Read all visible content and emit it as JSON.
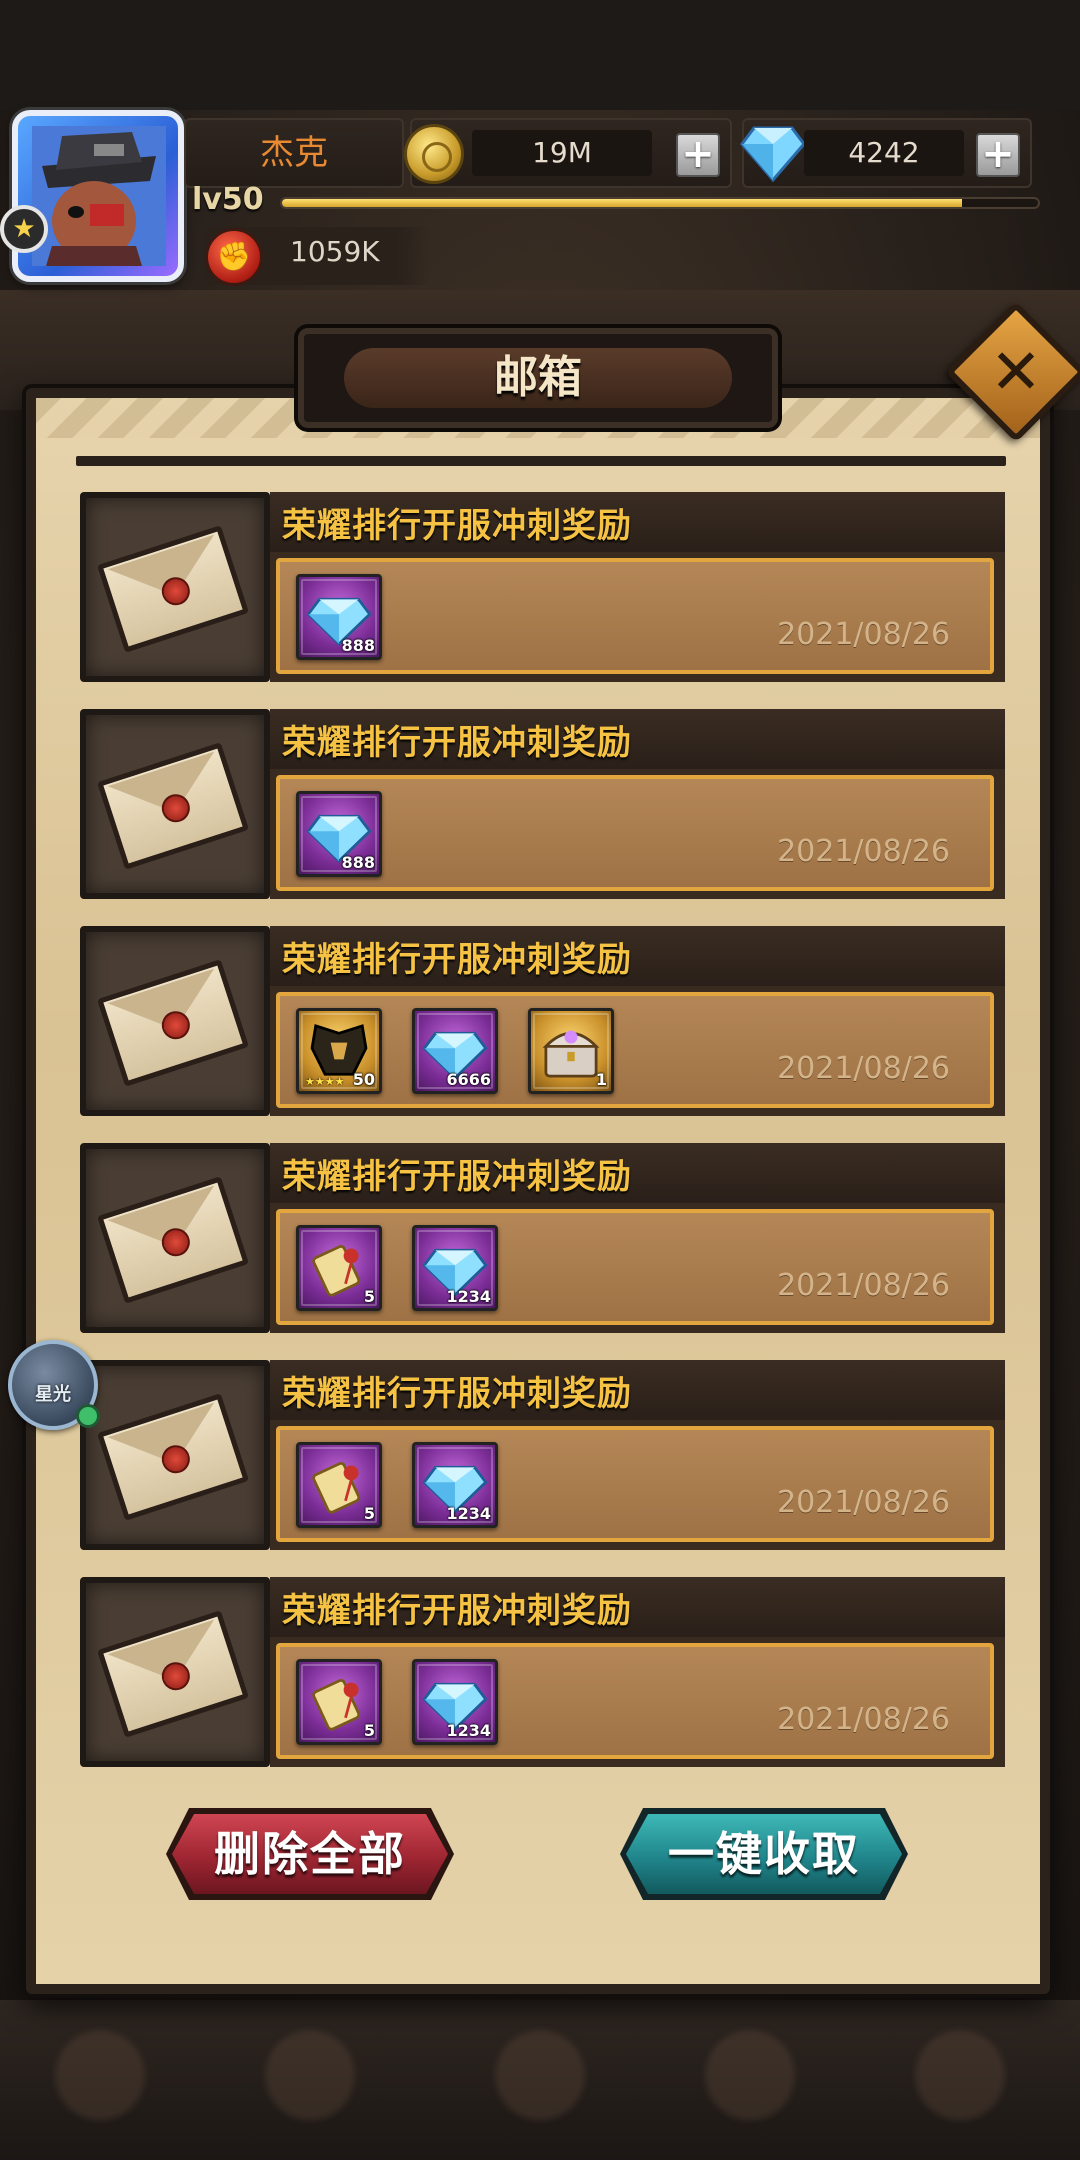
{
  "player": {
    "name": "杰克",
    "level": "lv50",
    "power": "1059K",
    "xp_fraction": 0.9
  },
  "currency": {
    "gold": "19M",
    "diamonds": "4242"
  },
  "panel": {
    "title": "邮箱"
  },
  "mails": [
    {
      "title": "荣耀排行开服冲刺奖励",
      "date": "2021/08/26",
      "items": [
        {
          "icon": "diamond-icon",
          "frame": "purple",
          "count": "888"
        }
      ]
    },
    {
      "title": "荣耀排行开服冲刺奖励",
      "date": "2021/08/26",
      "items": [
        {
          "icon": "diamond-icon",
          "frame": "purple",
          "count": "888"
        }
      ]
    },
    {
      "title": "荣耀排行开服冲刺奖励",
      "date": "2021/08/26",
      "items": [
        {
          "icon": "armor-icon",
          "frame": "gold",
          "count": "50",
          "stars": "★★★★"
        },
        {
          "icon": "diamond-icon",
          "frame": "purple",
          "count": "6666"
        },
        {
          "icon": "treasure-chest-icon",
          "frame": "gold",
          "count": "1"
        }
      ]
    },
    {
      "title": "荣耀排行开服冲刺奖励",
      "date": "2021/08/26",
      "items": [
        {
          "icon": "scroll-icon",
          "frame": "purple",
          "count": "5"
        },
        {
          "icon": "diamond-icon",
          "frame": "purple",
          "count": "1234"
        }
      ]
    },
    {
      "title": "荣耀排行开服冲刺奖励",
      "date": "2021/08/26",
      "items": [
        {
          "icon": "scroll-icon",
          "frame": "purple",
          "count": "5"
        },
        {
          "icon": "diamond-icon",
          "frame": "purple",
          "count": "1234"
        }
      ]
    },
    {
      "title": "荣耀排行开服冲刺奖励",
      "date": "2021/08/26",
      "items": [
        {
          "icon": "scroll-icon",
          "frame": "purple",
          "count": "5"
        },
        {
          "icon": "diamond-icon",
          "frame": "purple",
          "count": "1234"
        }
      ]
    }
  ],
  "buttons": {
    "delete_all": "删除全部",
    "collect_all": "一键收取"
  },
  "side_bubble": {
    "label": "星光"
  },
  "colors": {
    "title_gold": "#f5c243",
    "name_orange": "#e88a32",
    "delete_red": "#9e2632",
    "collect_teal": "#20868c"
  }
}
